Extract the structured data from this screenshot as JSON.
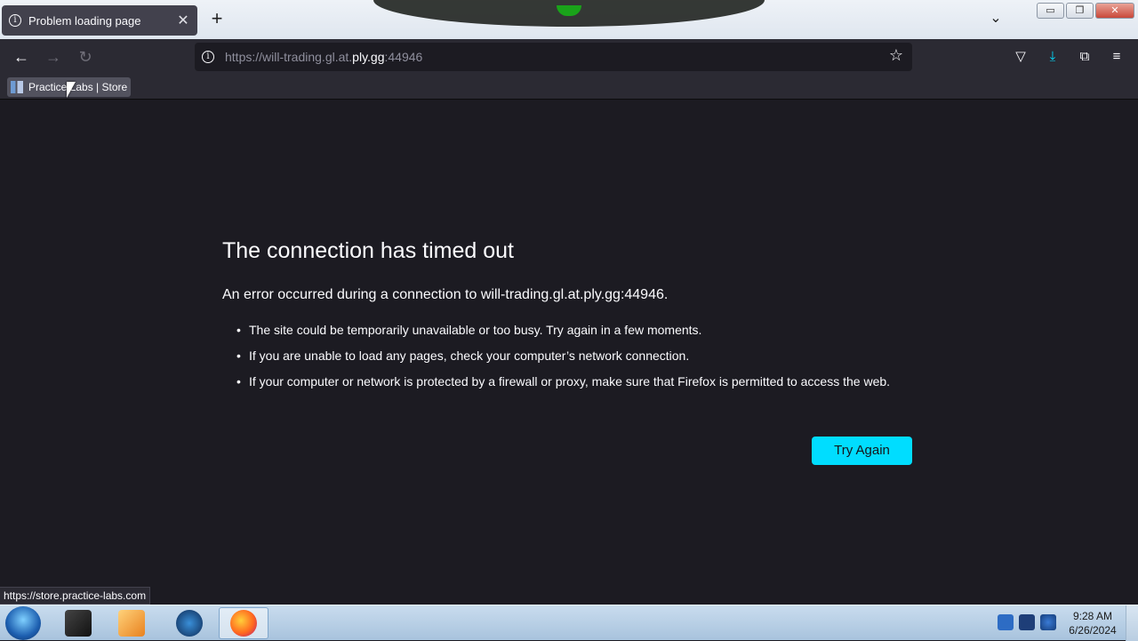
{
  "tab": {
    "title": "Problem loading page",
    "close": "✕"
  },
  "toolbar": {
    "new_tab": "+",
    "list_tabs": "⌄"
  },
  "window": {
    "minimize": "▭",
    "restore": "❐",
    "close": "✕"
  },
  "nav": {
    "back": "←",
    "forward": "→",
    "reload": "↻",
    "url_prefix": "https://will-trading.gl.at.",
    "url_host": "ply.gg",
    "url_suffix": ":44946",
    "star": "☆"
  },
  "tools": {
    "pocket": "▽",
    "downloads": "⤓",
    "extensions": "⧉",
    "menu": "≡"
  },
  "bookmarks": [
    {
      "label": "Practice Labs | Store"
    }
  ],
  "error": {
    "title": "The connection has timed out",
    "description": "An error occurred during a connection to will-trading.gl.at.ply.gg:44946.",
    "bullets": [
      "The site could be temporarily unavailable or too busy. Try again in a few moments.",
      "If you are unable to load any pages, check your computer’s network connection.",
      "If your computer or network is protected by a firewall or proxy, make sure that Firefox is permitted to access the web."
    ],
    "button": "Try Again"
  },
  "status_bar": "https://store.practice-labs.com",
  "taskbar": {
    "time": "9:28 AM",
    "date": "6/26/2024",
    "apps": [
      "terminal",
      "media-player",
      "network-globe",
      "firefox"
    ]
  },
  "colors": {
    "accent": "#00ddff",
    "page_bg": "#1c1b22",
    "toolbar_bg": "#2b2a33"
  }
}
